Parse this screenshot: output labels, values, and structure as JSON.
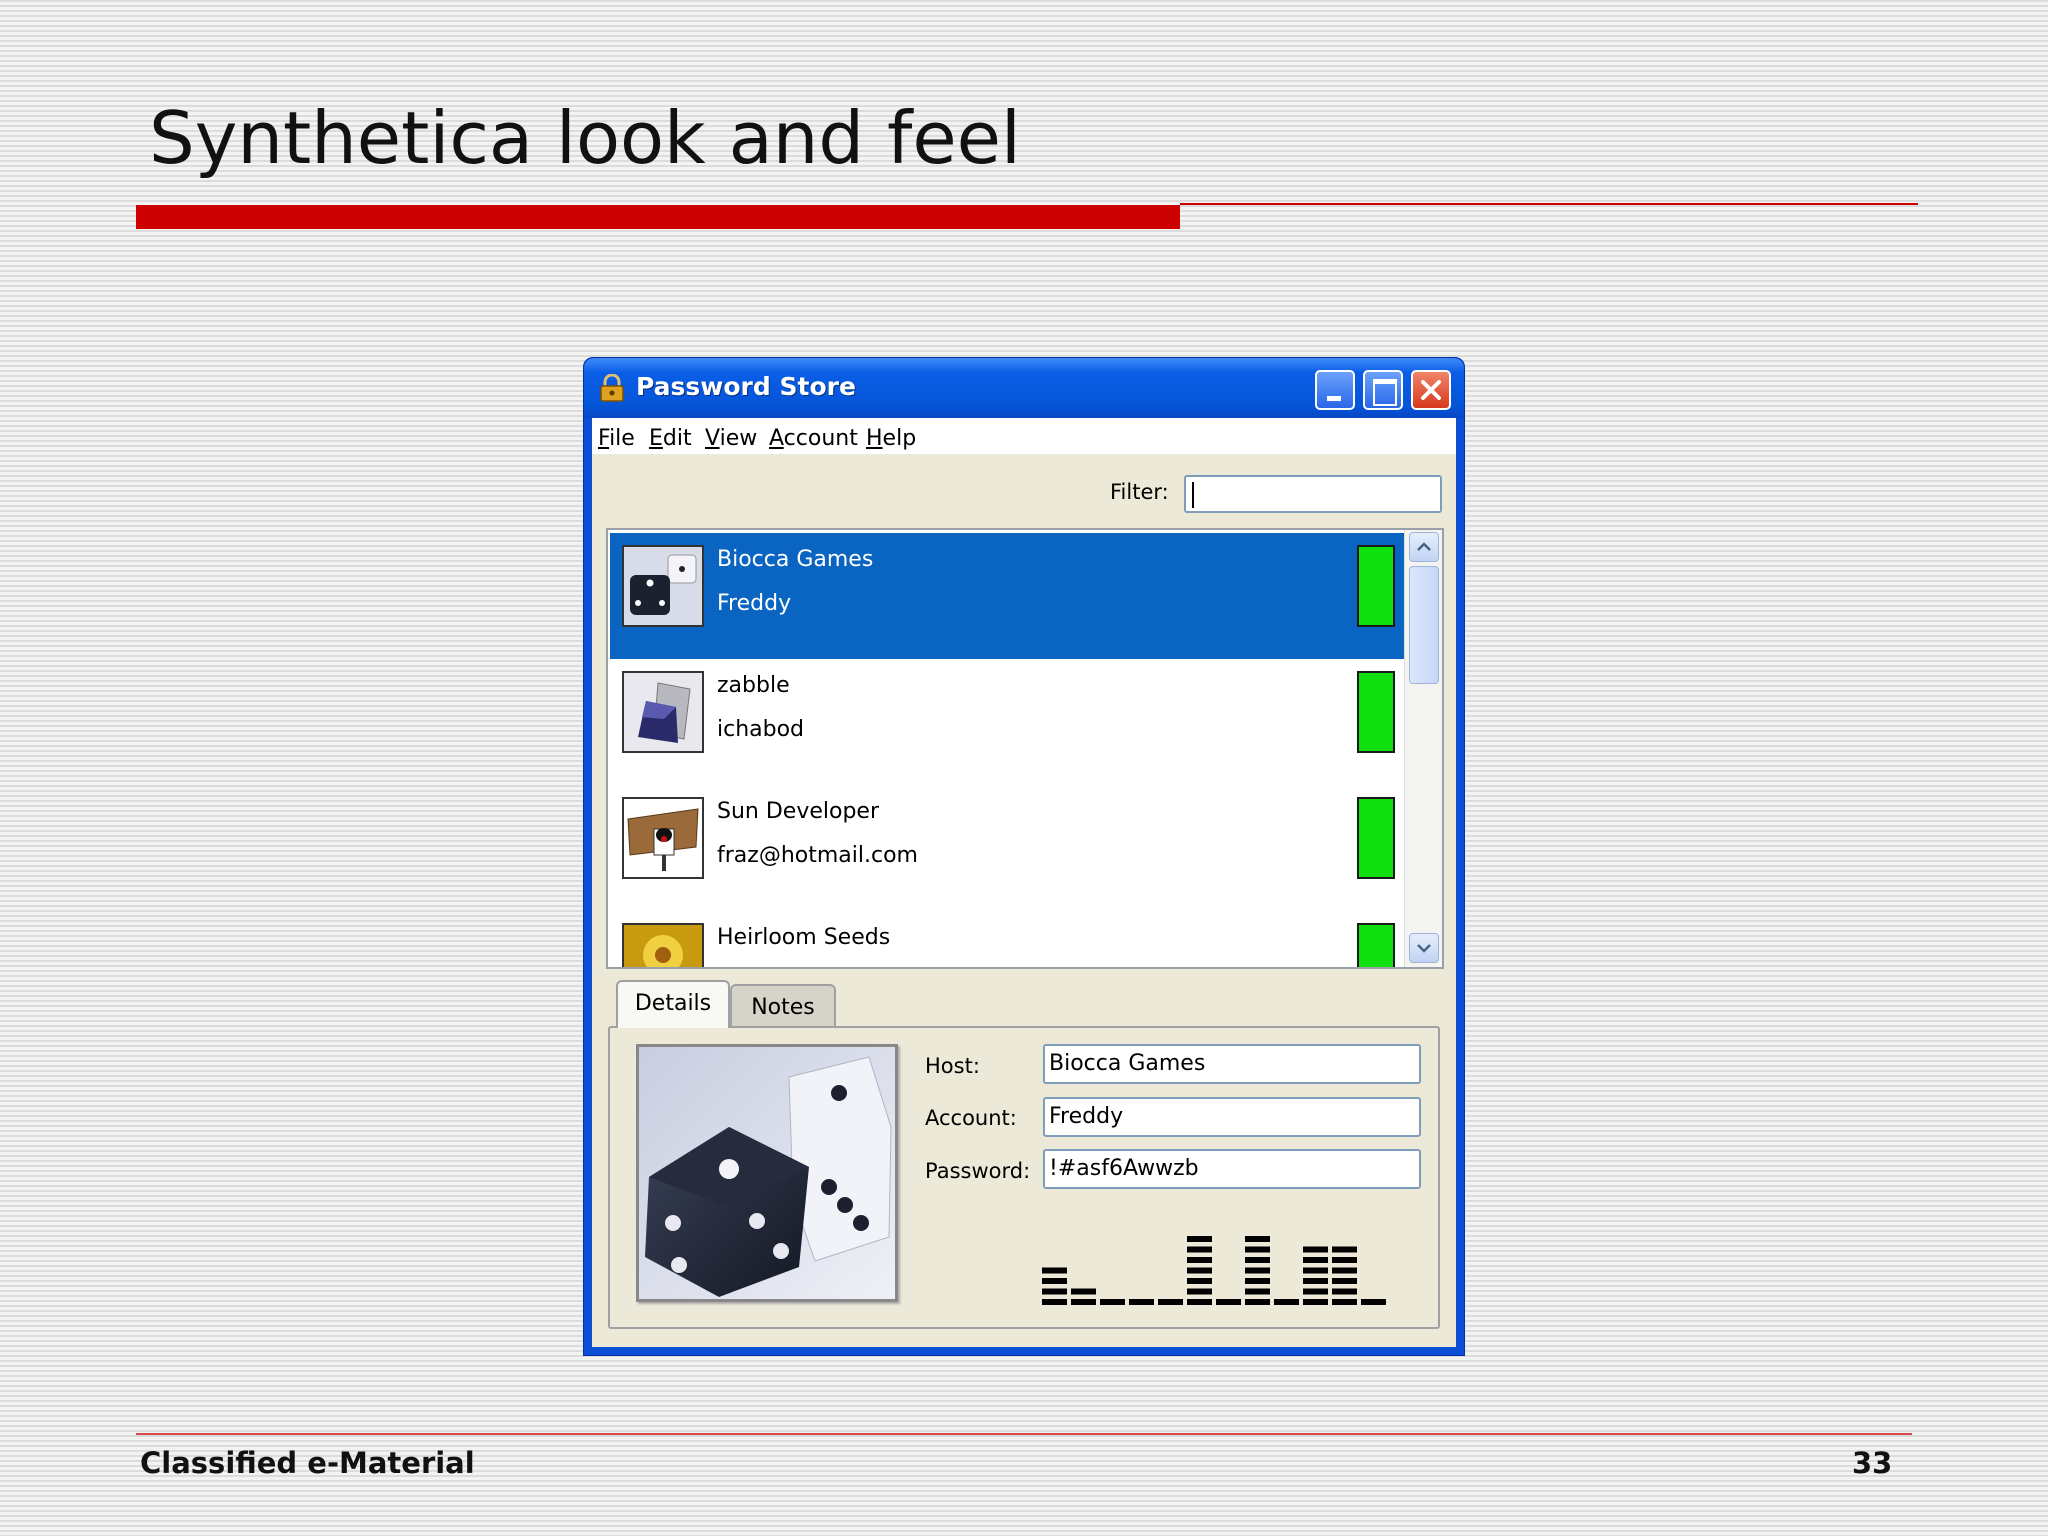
{
  "slide": {
    "title": "Synthetica look and feel",
    "footer_left": "Classified e-Material",
    "page_number": "33"
  },
  "window": {
    "title": "Password Store",
    "menu": [
      {
        "mnemonic": "F",
        "rest": "ile"
      },
      {
        "mnemonic": "E",
        "rest": "dit"
      },
      {
        "mnemonic": "V",
        "rest": "iew"
      },
      {
        "mnemonic": "A",
        "rest": "ccount"
      },
      {
        "mnemonic": "H",
        "rest": "elp"
      }
    ],
    "filter_label": "Filter:",
    "filter_value": ""
  },
  "accounts": [
    {
      "host": "Biocca Games",
      "account": "Freddy",
      "icon": "dice-icon",
      "selected": true
    },
    {
      "host": "zabble",
      "account": "ichabod",
      "icon": "folder-icon",
      "selected": false
    },
    {
      "host": "Sun Developer",
      "account": "fraz@hotmail.com",
      "icon": "duke-icon",
      "selected": false
    },
    {
      "host": "Heirloom Seeds",
      "account": "",
      "icon": "flower-icon",
      "selected": false
    }
  ],
  "tabs": {
    "details": "Details",
    "notes": "Notes"
  },
  "details": {
    "host_label": "Host:",
    "host_value": "Biocca Games",
    "account_label": "Account:",
    "account_value": "Freddy",
    "password_label": "Password:",
    "password_value": "!#asf6Awwzb",
    "password_chart": [
      4,
      2,
      1,
      1,
      1,
      7,
      1,
      7,
      1,
      6,
      6,
      0
    ]
  },
  "colors": {
    "accent_red": "#cc0000",
    "selection": "#0a64c2",
    "strength_good": "#10e010",
    "titlebar_blue": "#0555d8"
  }
}
